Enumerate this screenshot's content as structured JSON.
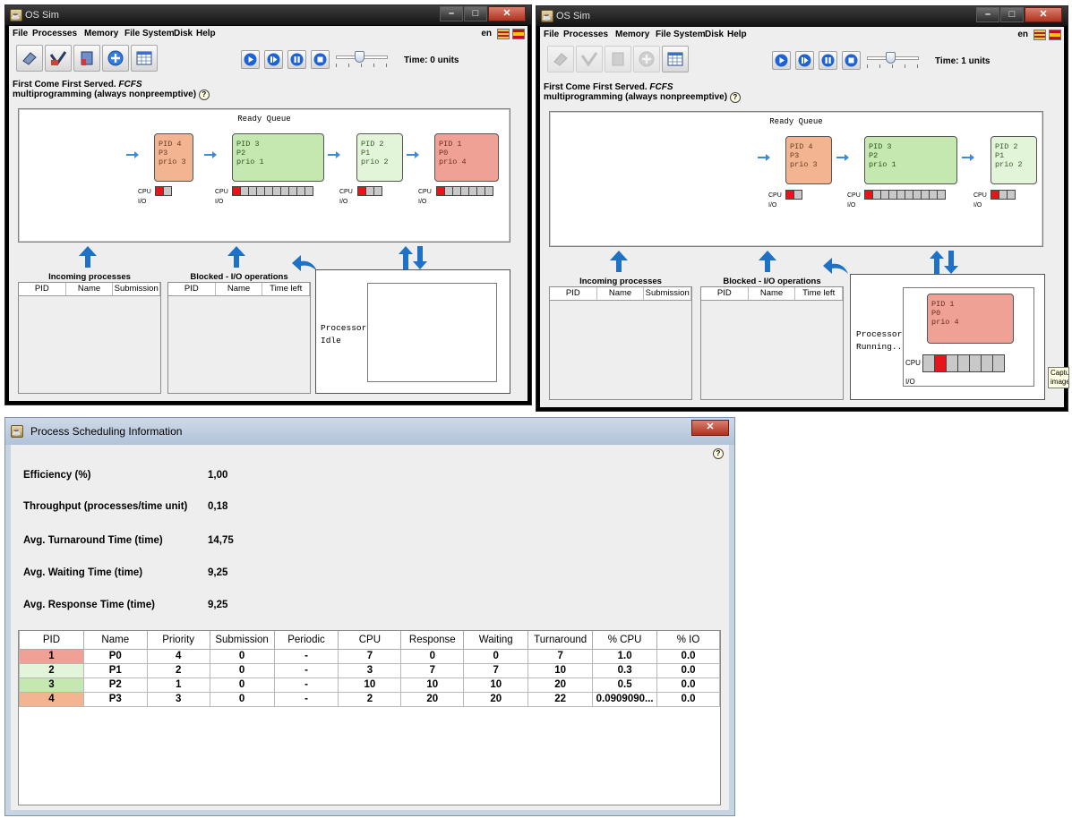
{
  "osim_app": {
    "window_title": "OS Sim",
    "menu": [
      "File",
      "Processes",
      "Memory",
      "File System",
      "Disk",
      "Help"
    ],
    "language": "en",
    "toolbar_icons": [
      "eraser-icon",
      "open-save-icon",
      "process-config-icon",
      "add-icon",
      "spreadsheet-icon"
    ],
    "playback_icons": [
      "play-icon",
      "step-icon",
      "pause-icon",
      "stop-icon"
    ],
    "algorithm_line1": "First Come First Served.",
    "algorithm_italic": "FCFS",
    "algorithm_line2": "multiprogramming (always nonpreemptive)",
    "ready_queue_title": "Ready Queue",
    "cpu_label": "CPU",
    "io_label": "I/O",
    "incoming_title": "Incoming processes",
    "incoming_columns": [
      "PID",
      "Name",
      "Submission"
    ],
    "blocked_title": "Blocked - I/O operations",
    "blocked_columns": [
      "PID",
      "Name",
      "Time left"
    ],
    "processor_label": "Processor"
  },
  "left_window": {
    "time_label": "Time: 0 units",
    "processor_status": "Idle",
    "ready_queue": [
      {
        "pid": "PID 4",
        "name": "P3",
        "prio": "prio 3",
        "color": "#f2b491",
        "cpu_bursts": 2,
        "cpu_active": 1
      },
      {
        "pid": "PID 3",
        "name": "P2",
        "prio": "prio 1",
        "color": "#c4e8b0",
        "cpu_bursts": 10,
        "cpu_active": 1
      },
      {
        "pid": "PID 2",
        "name": "P1",
        "prio": "prio 2",
        "color": "#e3f5d9",
        "cpu_bursts": 3,
        "cpu_active": 1
      },
      {
        "pid": "PID 1",
        "name": "P0",
        "prio": "prio 4",
        "color": "#f0a195",
        "cpu_bursts": 7,
        "cpu_active": 1
      }
    ]
  },
  "right_window": {
    "time_label": "Time: 1 units",
    "processor_status": "Running...",
    "running_process": {
      "pid": "PID 1",
      "name": "P0",
      "prio": "prio 4",
      "cpu_bursts": 7,
      "cpu_active": 2
    },
    "ready_queue": [
      {
        "pid": "PID 4",
        "name": "P3",
        "prio": "prio 3",
        "cpu_bursts": 2,
        "cpu_active": 1
      },
      {
        "pid": "PID 3",
        "name": "P2",
        "prio": "prio 1",
        "cpu_bursts": 10,
        "cpu_active": 1
      },
      {
        "pid": "PID 2",
        "name": "P1",
        "prio": "prio 2",
        "cpu_bursts": 3,
        "cpu_active": 1
      }
    ],
    "tooltip": "Capture image"
  },
  "stats_window": {
    "title": "Process Scheduling Information",
    "stats": [
      {
        "label": "Efficiency (%)",
        "value": "1,00"
      },
      {
        "label": "Throughput (processes/time unit)",
        "value": "0,18"
      },
      {
        "label": "Avg. Turnaround Time (time)",
        "value": "14,75"
      },
      {
        "label": "Avg. Waiting Time (time)",
        "value": "9,25"
      },
      {
        "label": "Avg. Response Time (time)",
        "value": "9,25"
      }
    ],
    "columns": [
      "PID",
      "Name",
      "Priority",
      "Submission",
      "Periodic",
      "CPU",
      "Response",
      "Waiting",
      "Turnaround",
      "% CPU",
      "% IO"
    ],
    "rows": [
      {
        "pid": "1",
        "name": "P0",
        "priority": "4",
        "submission": "0",
        "periodic": "-",
        "cpu": "7",
        "response": "0",
        "waiting": "0",
        "turnaround": "7",
        "pct_cpu": "1.0",
        "pct_io": "0.0",
        "color": "#f0a195"
      },
      {
        "pid": "2",
        "name": "P1",
        "priority": "2",
        "submission": "0",
        "periodic": "-",
        "cpu": "3",
        "response": "7",
        "waiting": "7",
        "turnaround": "10",
        "pct_cpu": "0.3",
        "pct_io": "0.0",
        "color": "#e3f5d9"
      },
      {
        "pid": "3",
        "name": "P2",
        "priority": "1",
        "submission": "0",
        "periodic": "-",
        "cpu": "10",
        "response": "10",
        "waiting": "10",
        "turnaround": "20",
        "pct_cpu": "0.5",
        "pct_io": "0.0",
        "color": "#c4e8b0"
      },
      {
        "pid": "4",
        "name": "P3",
        "priority": "3",
        "submission": "0",
        "periodic": "-",
        "cpu": "2",
        "response": "20",
        "waiting": "20",
        "turnaround": "22",
        "pct_cpu": "0.0909090...",
        "pct_io": "0.0",
        "color": "#f2b491"
      }
    ]
  }
}
